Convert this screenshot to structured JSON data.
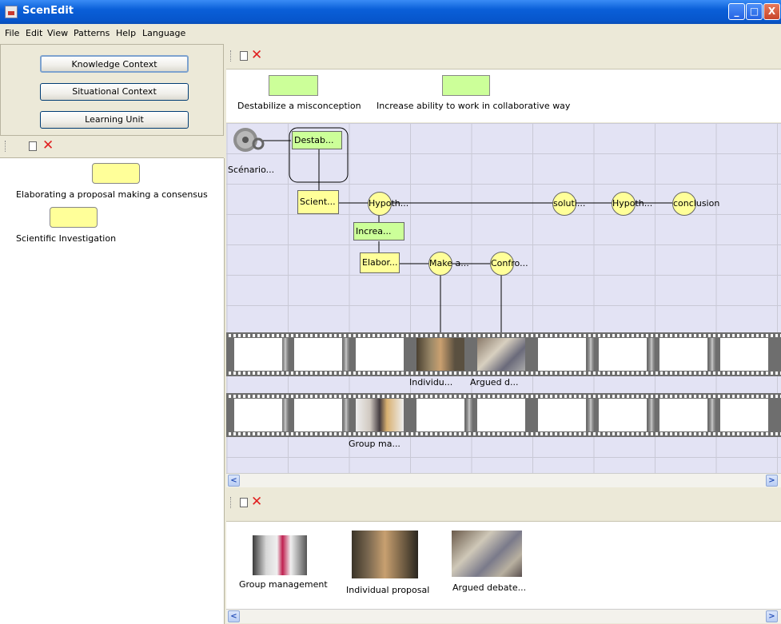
{
  "window": {
    "title": "ScenEdit",
    "min_btn": "_",
    "max_btn": "□",
    "close_btn": "X"
  },
  "menu": [
    "File",
    "Edit",
    "View",
    "Patterns",
    "Help",
    "Language"
  ],
  "left": {
    "context_buttons": [
      "Knowledge Context",
      "Situational Context",
      "Learning Unit"
    ],
    "items": [
      "Elaborating a proposal  making a consensus",
      "Scientific Investigation"
    ]
  },
  "objectives": [
    "Destabilize a misconception",
    "Increase ability to work in collaborative way"
  ],
  "scenario": {
    "scenario_label": "Scénario...",
    "rect_nodes": [
      "Destab...",
      "Scient...",
      "Increa...",
      "Elabor..."
    ],
    "circle_nodes": [
      "Hypoth...",
      "soluti...",
      "Hypoth...",
      "conclusion",
      "Make a...",
      "Confro..."
    ],
    "film_labels": [
      "Individu...",
      "Argued d...",
      "Group ma..."
    ]
  },
  "resources": [
    "Group management",
    "Individual proposal",
    "Argued debate..."
  ],
  "scroll": {
    "left": "<",
    "right": ">"
  },
  "toolbar": {
    "delete": "✕"
  },
  "colors": {
    "titlebar": "#0756cc",
    "objective": "#ccff99",
    "activity": "#ffff99",
    "grid": "#e3e3f4"
  }
}
